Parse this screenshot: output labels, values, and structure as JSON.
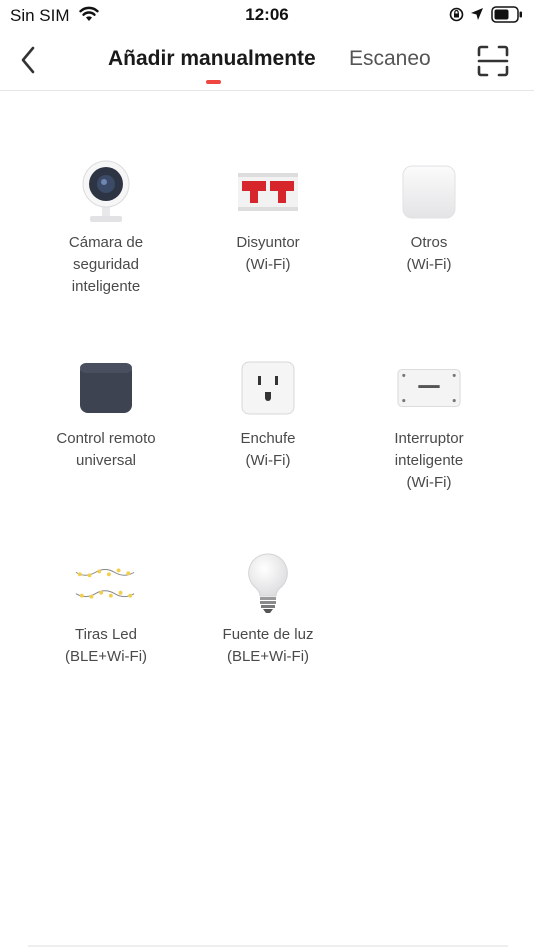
{
  "status_bar": {
    "carrier": "Sin SIM",
    "time": "12:06"
  },
  "nav": {
    "tabs": [
      {
        "label": "Añadir manualmente",
        "active": true
      },
      {
        "label": "Escaneo",
        "active": false
      }
    ],
    "accent_color": "#f04640"
  },
  "devices": [
    {
      "lines": [
        "Cámara de",
        "seguridad",
        "inteligente"
      ],
      "icon": "security-camera-icon"
    },
    {
      "lines": [
        "Disyuntor",
        "(Wi-Fi)"
      ],
      "icon": "circuit-breaker-icon"
    },
    {
      "lines": [
        "Otros",
        "(Wi-Fi)"
      ],
      "icon": "generic-device-icon"
    },
    {
      "lines": [
        "Control remoto",
        "universal"
      ],
      "icon": "remote-hub-icon"
    },
    {
      "lines": [
        "Enchufe",
        "(Wi-Fi)"
      ],
      "icon": "outlet-icon"
    },
    {
      "lines": [
        "Interruptor",
        "inteligente",
        "(Wi-Fi)"
      ],
      "icon": "smart-switch-icon"
    },
    {
      "lines": [
        "Tiras Led",
        "(BLE+Wi-Fi)"
      ],
      "icon": "led-strip-icon"
    },
    {
      "lines": [
        "Fuente de luz",
        "(BLE+Wi-Fi)"
      ],
      "icon": "light-bulb-icon"
    }
  ]
}
